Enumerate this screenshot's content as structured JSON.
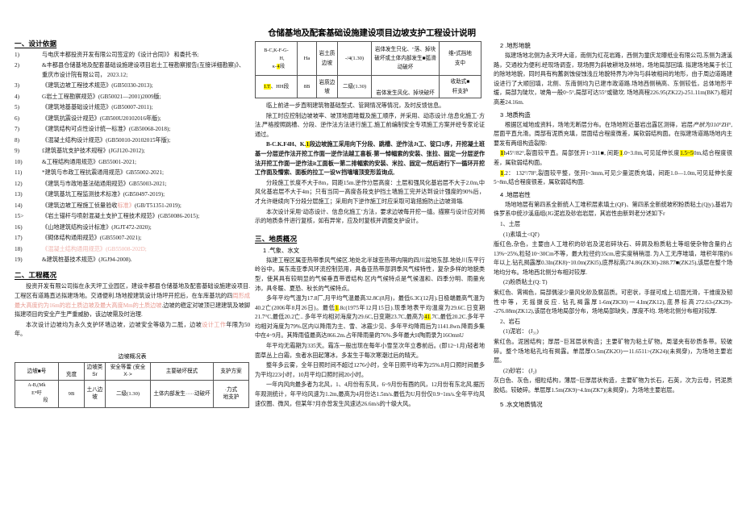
{
  "document": {
    "title": "仓储基地及配套基础设施建设项目边坡支护工程设计说明"
  },
  "left_column": {
    "section1_heading": "一、设计依据",
    "basis_items": [
      {
        "num": "1)",
        "text": "与电庆丰都投资开发有限公司签定的《设计合同》》 和委托书;"
      },
      {
        "num": "2)",
        "text": "&丰都县仓储基地及配套基础设施建设项目岩土工程勘察报告(互接详细勘察)》、重庆市设计院有限公司， 2023.12;"
      },
      {
        "num": "3)",
        "text": "《建筑边坡工程技术规范》(GB50330-2013);"
      },
      {
        "num": "4)",
        "text": "G岩土工程勘察规范》(GB50021—2001)2009版;"
      },
      {
        "num": "5)",
        "text": "《建筑地基基础设计规范》(GB50007-2011);"
      },
      {
        "num": "6)",
        "text": "《建筑抗震设计规范》(GB500U20102016年版);"
      },
      {
        "num": "7)",
        "text": "《建筑结构可点性设计统一标准》(GB50068-2018);"
      },
      {
        "num": "8)",
        "text": "《混凝土结构设计规范》(GB50010-20102015年版);"
      },
      {
        "num": "9)",
        "text": "£建筑基坑支护技术规程》(JGJ120-2012);"
      },
      {
        "num": "10)",
        "text": "&工程结构通用规范》GB55001-2021;"
      },
      {
        "num": "11)",
        "text": "*建筑与市政工程抗震通用规范》GB55002-2021;"
      },
      {
        "num": "12)",
        "text": "《建筑与市政地基法础通用规范》GB55003-2021;"
      },
      {
        "num": "13)",
        "text": "《建筑基坑工程监测技术标准》(GB50497-2019);"
      },
      {
        "num": "14)",
        "text_pre": "《建筑边坡工程施工侦量验收",
        "text_red": "标准》",
        "text_post": "(GB/T51351-2019);"
      },
      {
        "num": "15>",
        "text": "《岩土锚杆与喷射混凝土支护工程技术规范》(GB50086-2015);"
      },
      {
        "num": "16)",
        "text": "《山地建筑结构设计标准》(JGJT472-2020);"
      },
      {
        "num": "17)",
        "text": "《砌体结构通用规范》(GB55007-2021);"
      },
      {
        "num": "18)",
        "text": "《混凝土结构通用规范》(GB55008-202D;",
        "color": "pink"
      },
      {
        "num": "19)",
        "text": "&建筑桩基技术规范》(JGJ94-2008)."
      }
    ],
    "section2_heading": "二、工程概况",
    "overview_p1_a": "投资开发有限公司拟在永天坪工业园区，建设丰都县仓储基地及配套基础设施建设项目.工程区有道路直达拟建场地。交通便利.场地按建筑设计场坪开挖后，在车库基坑的四",
    "overview_p1_red": "周形成最大高度约为16m的岩土质边坡及最大高度Mm的土质边坡",
    "overview_p1_b": ".边坡的稳定对坡顶已建建筑及坡脚拟建项目的安全产生严重威胁，该边坡需及时治理.",
    "overview_p2_a": "本次设计边坡均为永久支护环墙边坡，边坡安全等级为二胝，边坡",
    "overview_p2_red": "设计工作",
    "overview_p2_b": "年限为50年。",
    "table_caption": "边坡概况表",
    "table_headers": [
      "边坡■号",
      "充度",
      "边坡类Sr",
      "安全等藿 (安全 X·>",
      "主要破坏模式",
      "支护方案"
    ],
    "table_rows": [
      {
        "c0_line1": "A-B,(Mk",
        "c0_line2": "E*吁",
        "c0_line3": "段",
        "c1": "9B",
        "c2": "土八边坡",
        "c3": "二级(1.30)",
        "c4": "土体内部发生·····动破坏",
        "c5_line1": "·力式",
        "c5_line2": "地支护"
      }
    ]
  },
  "mid_column": {
    "top_table_headers_note": "",
    "top_table_rows": [
      {
        "c0_line1": "B-C,K-F-G-",
        "c0_line2": "H,",
        "c0_line3_pre": "κ-",
        "c0_line3_hl": "4",
        "c0_line3_post": "段",
        "c1": "Ha",
        "c2": "岩土质边坡",
        "c3": "-/4(1.30)",
        "c4": "岩体发生只化、\"落、掉块破坏或土体内部发生■弧滑动破坏",
        "c5_line1": "维•式挡地",
        "c5_line2": "支中"
      },
      {
        "c0_hl": "I.T",
        "c0_post": "、HH段",
        "c1": "8B",
        "c2": "岩质边坡",
        "c3": "二级(1.30)",
        "c4": "岩体发生风化、掉块破坏",
        "c5_line1": "收助式■",
        "c5_line2": "杆支护"
      }
    ],
    "p_after_table1": "临上前进一步直明建筑物基础型式、管网情况等情况，及时反馈信息。",
    "p_after_table2": "除工时应控制边坡坡率、坡顶地面堆载及施工顺序，并采用、动态设计.信息化施工·方法.严格按照跳槽、分段、逆作法方法进行施工.施工前编制安全专项施工方案并经专家论证通过。",
    "p_bck_pre": "B-C.K.F4H、K.",
    "p_bck_hl": "1",
    "p_bck_post": "段边坡施工采用向下分段、跳槽、逆作法Jt工、锭口1序，开挖凝土班基一分层逆作法开挖工作面一逆作法越工喜板-第一悼幅索的安装、张拉、固定一分层逆作法开挖工作面一逆作法it工面板一第二排幅索的安装、米拉、固定一然后进行下一循环开挖工作面及懵索、面板的拉工一设W挡墙墙顶变形监询点,",
    "p_seg": "分段施工长度不大于8m，同距15m.逆作分层高度：土层和强风化基岩层不大于2.0m,中风化基岩层不大于4m；只有当同一高度各段支护挡土墙施工完并达到设计强度的90%后，才允许继续向下分段分层施工；采用向下逆作施工时应采取可靠措施防止边坡滑塌.",
    "p_dyn": "本次设计采用‘动态设计、信息化施工’方法，要求边坡每开挖一缝。描察与设计应对揭示的地质条件进行复核，如有异常，应及时复核并调整支护设计。",
    "section3_heading": "三、地质概况",
    "sub1_heading": "1 .气象、水文",
    "p_clim1": "拟建工程区属亚热带季风气候区.地处北半球亚热带内隔的四川盆地东部.地处川东平行岭谷中。属东南亚季风环流控制范用，具备亚热带部洞季风气候特性，复杂多样的地貌类型，使其具有较明显的气候垂直带谱结构.区内气候特点是气候温和、四季分明、雨量充沛，具冬暖、夏恐、秋长的气候特点。",
    "p_clim2_a": "多年平均气温为17.8厂,月平均气温最高32.8C(8月)，最低6.3C(12月).日极端最高气温为40.2亡(2006年8月26日)。最低",
    "p_clim2_hl": "1",
    "p_clim2_b": ".8c(1975年12月15日).现季地表平均温度为29.6C.日变期21.7°C,最低20.2亡.. 多年平均相对海度为29.6C,日变期23.7C,最高为",
    "p_clim2_hl2": "41",
    "p_clim2_c": ".7C,最低20.2C.多年平均相对海度为79%.区内以降雨为主、雪、冰霰少见、多年平均降雨后为1141.8wn.降雨多集中在4~9月。其降雨值最高达866.2m.占年降雨量的76%.多年最大H陶雨录为16OmnU",
    "p_frost": "年平均无霜期为335天。霜冻一般出现在每年小雪至次年立春前后。(即12~1月)轻者地面草丛上白霜，虫者水田起薄冰，多发生于每次寒潮过后的晴天。",
    "p_sun": "整年多云雾，全年日照时间不超过1276小时，全年日照平均率为25%.8月口照时间最多为平均223小时，10月平均口照时间20小时。",
    "p_wind": "一年内风向最多者为北风，1、4月份有东风，6~9月份有酉的风，12月份有东北风.据历年观测统计，年平均风速为1.2m,最高为4月份达1.5m/s.最低为U月份仅0.9~1m/s.全年平均风速仅圈、微风，但某年7月亦曾发生风速达26.6m/s的十级大风。"
  },
  "right_column": {
    "sub2_heading": "2 .地形地貌",
    "p_topo": "拟建场地北侧为永天坪大道，南侧为红花岩路，西侧为童庆龙曝纸业有限公司,东侧为溏溪路，交通校为便利.经现场调查，现场腭为斜坡耕地及林地，场地局部回填. 拟建场地属于长江的除地地貌，同时具有构蓄剥蚀侵蚀浅丘地貌特界为冲沟与斜坡相间的地形，由于周边道路建设进行了大顺回填，北侧、东南侧均为已建市政道路.场地西侧稍高、东侧较低，总体地形平缓，局部为陡坎，坡角一般0~5°,局部可达55°或徽坎. 场地高程226.95(ZK22)-251.11m(BK7).相对高差24.16m.",
    "sub3_heading": "3 .地质构造",
    "p_struct_a": "根据区域地成资料，场地无断层分布。在场地附近基岩出露区测得，岩层",
    "p_struct_italic": "产狀为310°ZH°",
    "p_struct_b": ",层面平直允滑。周部有泥质充填，层面结合程度微差，属软弱结构面。在拟建场道路场地内主要发有两组构造裂隙:",
    "joint1_hl": "1",
    "joint1_a": "h45°/82°,裂面较平直。局部张开1~311■, 间距",
    "joint1_hl2": "1",
    "joint1_b": ".0~3.0m,可见延伸长度",
    "joint1_hl3": "1.5~5",
    "joint1_c": "0m,结合程度很差，属软弱结构面。",
    "joint2_hl": "1",
    "joint2_a": ".2： 132°/78°,裂面较平整，张开l~3mm,可见少量泥质充填，间距1.0—1.0m,可见延伸长度5~8m,结合程度很差，属软弱结构面.",
    "sub4_heading": "4 .地层岩性",
    "p_strata": "场地地层有第四系全新统人工堆积层素填土(QF)、第四系全新统坡积粉质粘土(Q|y),基岩为侏罗系中统沙溪庙组(JG泥岩及砂岩岩层，其岩性由新到老分述如下r",
    "soil_heading": "1、土层",
    "soil1_title": "(1)素填土<QI')",
    "soil1_text": "版红色,杂色，主要由人工堆积的砂岩及泥岩碎块石、碎屑及粉质粘土等组使杂物含量约占13%~25%,粒轻10~30Cm不等，最大粒径约35cm,密实度稍稍湿. 为人工无序堆填，堆积年限约6年以上.钻孔揭露厚0.3In(ZK8)~10.0m(ZKl5),底界标高274.86(ZK30)-288.77■(ZK25),该层在整个场地均分布。场地西北侧分布相对较厚.",
    "soil2_title": "(2)粉质粘土(Q: T)",
    "soil2_text": "紫红色、霄褐色，局部偶浸少量风化砂及腐苗质。可密状，手提可成上.切面光滑，干维度及韧性中等，无摇摄反应. 钻孔褐露厚1-6m(ZK30)一4.Im(ZK12),底界标高272.63-(ZK29)--276.08m(ZK12),该层在场地局部分布，场地局部缺失，厚度不均. 场地北侧分布相对较厚.",
    "rock_heading": "2、岩石",
    "rock1_title": "(1)泥岩： (J₃₁)",
    "rock1_text": "紫红色。泥困结构；厚层~巨耳层状构造；主要矿物为粘土矿物。周溜夹有砂质条带。较破碎。整个场地粘孔均有揭露。单层厚O.5m(ZK2O)一11.6511>(ZK24)(未揭穿)，为场地主要岩层。",
    "rock2_title": "(2)砂岩： (J₂)",
    "rock2_text": "灰白色、灰色，细粒结构，薄层~巨厚层状构造，主要矿物为长石，石英，次为云母，钙泥质胶结。较破碎。单层厚1.5m(ZK9)~4.Im(ZK7)(未揭穿)，为场地主要岩层。",
    "sub5_heading": "5 .水文地质情况"
  },
  "colors": {
    "highlight": "#fff200",
    "red_text": "#e8998f",
    "pink_text": "#efb4ae",
    "blue_text": "#4a6fa5",
    "border": "#555555"
  }
}
